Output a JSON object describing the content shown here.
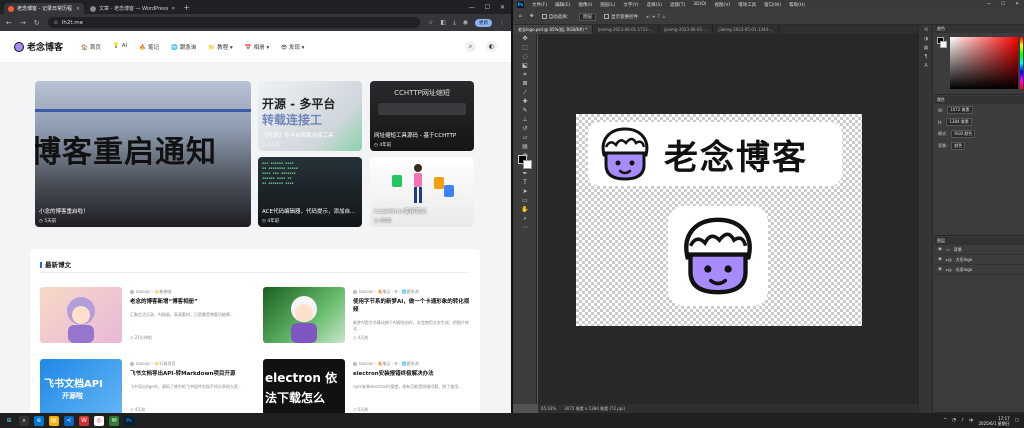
{
  "browser": {
    "tabs": [
      {
        "label": "老念博客 - 记录日常历程",
        "active": true
      },
      {
        "label": "文章 - 老念博客 — WordPress",
        "active": false
      }
    ],
    "url": "lh2t.me",
    "update_label": "更新"
  },
  "site": {
    "logo_text": "老念博客",
    "menu": [
      {
        "icon": "🏠",
        "label": "首页"
      },
      {
        "icon": "💡",
        "label": "AI"
      },
      {
        "icon": "🔥",
        "label": "笔记"
      },
      {
        "icon": "🌐",
        "label": "跟急询"
      },
      {
        "icon": "📁",
        "label": "教程 ▾"
      },
      {
        "icon": "📅",
        "label": "相册 ▾"
      },
      {
        "icon": "😎",
        "label": "发现 ▾"
      }
    ]
  },
  "featured": {
    "hero": {
      "title": "小念的博客重启啦！",
      "comments": "5天前",
      "image_text": "博客重启通知"
    },
    "tiles": [
      {
        "title": "【开源】多平台转载连接工具",
        "meta": "4天前",
        "image_text": "开源 - 多平台",
        "image_text2": "转载连接工"
      },
      {
        "title": "网址缩短工具源码 - 基于CCHTTP",
        "meta": "4年前",
        "image_text": "CCHTTP网址缩短"
      },
      {
        "title": "ACE代码编辑器，代码提示，添加自...",
        "meta": "4年前"
      },
      {
        "title": "CodeMirror使用笔记",
        "meta": "4年前"
      }
    ]
  },
  "latest": {
    "section_title": "最新博文",
    "posts": [
      {
        "meta": "laonian · 📁新修咖",
        "title": "老念的博客新增“博客相册”",
        "desc": "汇聚生活记录、AI插画、高清素材，已是最受博客功能模...",
        "time": "21分钟前"
      },
      {
        "meta": "laonian · 🔥笔记 · ⚙ · 🌐跟急询",
        "title": "使用字节系的新梦AI，做一个卡通形象的转化视频",
        "desc": "新梦AI是字节跳动旗下AI视觉创作，学会使用文本生成，把图片转化...",
        "time": "4天前"
      },
      {
        "meta": "laonian · 📁开源项目",
        "title": "飞书文档导出API-转Markdown项目开源",
        "desc": "飞书导出Agent，源码了其中的飞书组件实现不如分享给大家...",
        "time": "4天前"
      },
      {
        "meta": "laonian · 🔥笔记 · ⚙ · 🌐跟急询",
        "title": "electron安装报错终极解决办法",
        "desc": "npm安装electron时报错，很有可能是网络问题，除了使用...",
        "time": "5天前"
      }
    ],
    "thumb_texts": [
      "飞书文档API",
      "开源啦",
      "electron 依",
      "法下载怎么"
    ]
  },
  "photoshop": {
    "menu": [
      "文件(F)",
      "编辑(E)",
      "图像(I)",
      "图层(L)",
      "文字(Y)",
      "选择(S)",
      "滤镜(T)",
      "3D(D)",
      "视图(V)",
      "增效工具",
      "窗口(W)",
      "帮助(H)"
    ],
    "options": {
      "auto_select": "自动选择：",
      "layer_dropdown": "图层",
      "show_transform": "显示变换控件"
    },
    "doc_tabs": [
      "老念logo.psd @ 65%(组, RGB/8#) *",
      "jiieimg-2023-06-01-1712-...",
      "jiieimg-2023-06-01-...",
      "jiieimg-2023-05-01-1344-..."
    ],
    "banner_text": "老念博客",
    "status": {
      "zoom": "65.03%",
      "size": "3072 像素 x 1384 像素 (72 ppi)"
    },
    "props": [
      {
        "label": "W:",
        "value": "1072 像素"
      },
      {
        "label": "H:",
        "value": "1384 像素"
      },
      {
        "label": "模式:",
        "value": "RGB 颜色"
      },
      {
        "label": "背景:",
        "value": "颜色"
      }
    ],
    "layers": [
      "背景",
      "方形logo",
      "长条logo"
    ],
    "layers_title": "图层",
    "props_title": "属性",
    "color_title": "颜色"
  },
  "taskbar": {
    "time": "17:17",
    "date": "2025/6/1 星期日"
  }
}
